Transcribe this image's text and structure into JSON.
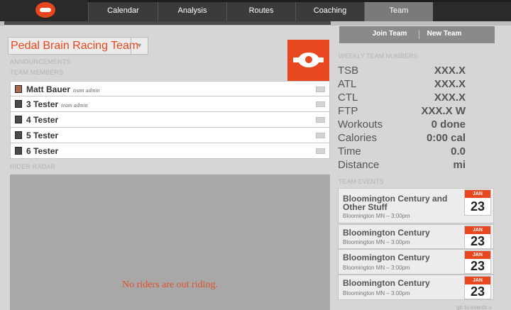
{
  "nav": {
    "tabs": [
      {
        "label": "Calendar"
      },
      {
        "label": "Analysis"
      },
      {
        "label": "Routes"
      },
      {
        "label": "Coaching"
      },
      {
        "label": "Team"
      }
    ],
    "active_tab": "Team"
  },
  "team": {
    "name": "Pedal Brain Racing Team",
    "announcements_label": "ANNOUNCEMENTS",
    "members_label": "TEAM MEMBERS",
    "members": [
      {
        "name": "Matt Bauer",
        "role": "team admin",
        "avatar": "photo"
      },
      {
        "name": "3 Tester",
        "role": "team admin",
        "avatar": "default"
      },
      {
        "name": "4 Tester",
        "role": "",
        "avatar": "default"
      },
      {
        "name": "5 Tester",
        "role": "",
        "avatar": "default"
      },
      {
        "name": "6 Tester",
        "role": "",
        "avatar": "default"
      }
    ]
  },
  "radar": {
    "label": "RIDER RADAR",
    "empty_message": "No riders are out riding."
  },
  "actions": {
    "join_team": "Join Team",
    "new_team": "New Team"
  },
  "weekly": {
    "label": "WEEKLY TEAM NUMBERS",
    "stats": [
      {
        "name": "TSB",
        "value": "XXX.X"
      },
      {
        "name": "ATL",
        "value": "XXX.X"
      },
      {
        "name": "CTL",
        "value": "XXX.X"
      },
      {
        "name": "FTP",
        "value": "XXX.X W"
      },
      {
        "name": "Workouts",
        "value": "0 done"
      },
      {
        "name": "Calories",
        "value": "0:00 cal"
      },
      {
        "name": "Time",
        "value": "0.0"
      },
      {
        "name": "Distance",
        "value": "mi"
      }
    ]
  },
  "events": {
    "label": "TEAM EVENTS",
    "items": [
      {
        "title": "Bloomington Century and Other Stuff",
        "subtitle": "Bloomington MN – 3:00pm",
        "month": "JAN",
        "day": "23"
      },
      {
        "title": "Bloomington Century",
        "subtitle": "Bloomington MN – 3:00pm",
        "month": "JAN",
        "day": "23"
      },
      {
        "title": "Bloomington Century",
        "subtitle": "Bloomington MN – 3:00pm",
        "month": "JAN",
        "day": "23"
      },
      {
        "title": "Bloomington Century",
        "subtitle": "Bloomington MN – 3:00pm",
        "month": "JAN",
        "day": "23"
      }
    ],
    "link": "go to events »"
  },
  "colors": {
    "accent": "#e8461e",
    "nav_background": "#1e1e1e",
    "page_background": "#d6d6d6"
  }
}
